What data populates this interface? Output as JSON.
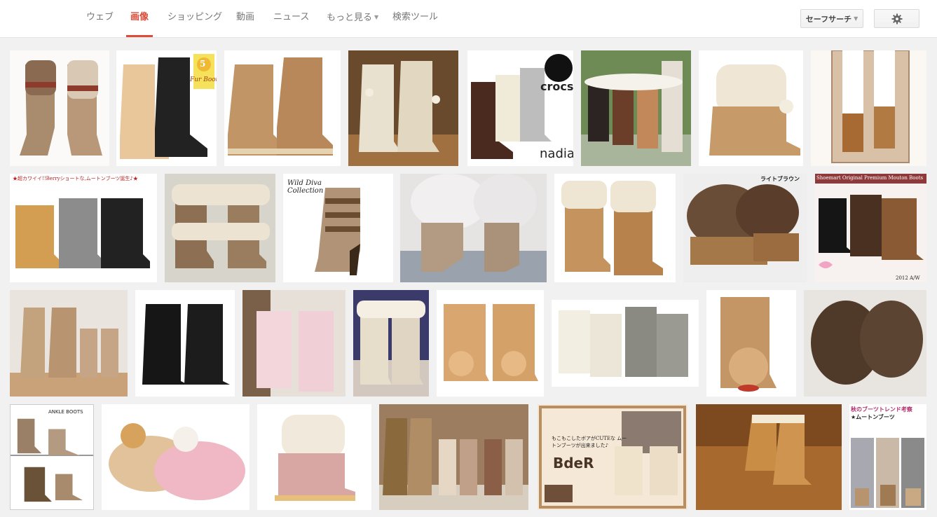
{
  "nav": {
    "tabs": [
      {
        "label": "ウェブ"
      },
      {
        "label": "画像"
      },
      {
        "label": "ショッピング"
      },
      {
        "label": "動画"
      },
      {
        "label": "ニュース"
      },
      {
        "label": "もっと見る"
      },
      {
        "label": "検索ツール"
      }
    ],
    "safesearch_label": "セーフサーチ"
  },
  "overlays": {
    "fur_boots": "Fur Boots",
    "fur_number": "5",
    "crocs": "crocs",
    "nadia": "nadia",
    "berry": "★超カワイイ!!Berryショートな,ムートンブーツ誕生♪★",
    "wild_diva": "Wild Diva Collection",
    "light_brown": "ライトブラウン",
    "shoemart": "Shoemart Original Premium Mouton Boots",
    "year": "2012 A/W",
    "ankle_boots": "ANKLE BOOTS",
    "bder": "BdeR",
    "bder_text": "もこもこしたボアがCUTEな ムートンブーツが出来ました♪",
    "trend_title": "秋のブーツトレンド考察",
    "trend_sub": "★ムートンブーツ"
  },
  "colors": {
    "accent": "#dd4b39",
    "boot_tan": "#c49a6c",
    "boot_brown": "#6b4a33",
    "fur_cream": "#efe6d6"
  }
}
